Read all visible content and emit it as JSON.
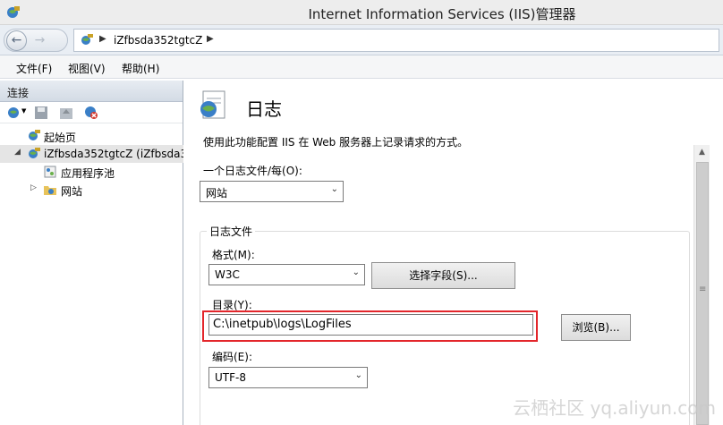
{
  "window": {
    "title": "Internet Information Services (IIS)管理器"
  },
  "address": {
    "crumb": "iZfbsda352tgtcZ"
  },
  "menu": {
    "file": "文件(F)",
    "view": "视图(V)",
    "help": "帮助(H)"
  },
  "connections": {
    "header": "连接",
    "tree": {
      "start_page": "起始页",
      "server": "iZfbsda352tgtcZ (iZfbsda35",
      "app_pools": "应用程序池",
      "sites": "网站"
    }
  },
  "main": {
    "title": "日志",
    "description": "使用此功能配置 IIS 在 Web 服务器上记录请求的方式。",
    "one_log_label": "一个日志文件/每(O):",
    "one_log_value": "网站",
    "log_file_group": "日志文件",
    "format_label": "格式(M):",
    "format_value": "W3C",
    "select_fields_button": "选择字段(S)...",
    "directory_label": "目录(Y):",
    "directory_value": "C:\\inetpub\\logs\\LogFiles",
    "browse_button": "浏览(B)...",
    "encoding_label": "编码(E):",
    "encoding_value": "UTF-8"
  },
  "watermark": "云栖社区 yq.aliyun.com",
  "colors": {
    "highlight": "#e3262b",
    "selected_row": "#e5e5e5"
  }
}
